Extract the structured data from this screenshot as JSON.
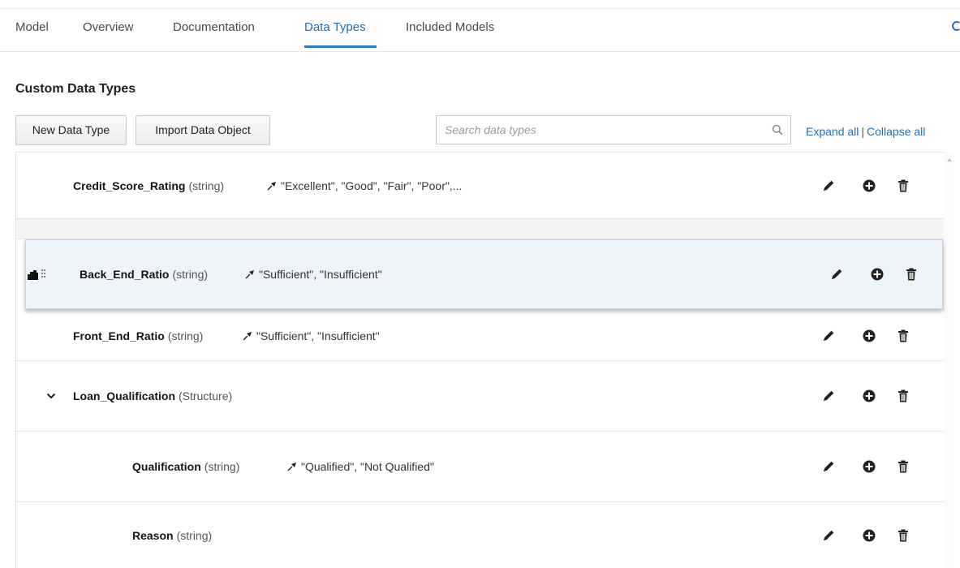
{
  "tabs": [
    {
      "label": "Model",
      "active": false
    },
    {
      "label": "Overview",
      "active": false
    },
    {
      "label": "Documentation",
      "active": false
    },
    {
      "label": "Data Types",
      "active": true
    },
    {
      "label": "Included Models",
      "active": false
    }
  ],
  "section": {
    "title": "Custom Data Types"
  },
  "toolbar": {
    "new_label": "New Data Type",
    "import_label": "Import Data Object",
    "search_placeholder": "Search data types",
    "expand_all": "Expand all",
    "separator": "|",
    "collapse_all": "Collapse all"
  },
  "rows": [
    {
      "name": "Credit_Score_Rating",
      "type": "(string)",
      "constraint": "\"Excellent\", \"Good\", \"Fair\", \"Poor\",..."
    },
    {
      "name": "Back_End_Ratio",
      "type": "(string)",
      "constraint": "\"Sufficient\", \"Insufficient\"",
      "dragging": true
    },
    {
      "name": "Front_End_Ratio",
      "type": "(string)",
      "constraint": "\"Sufficient\", \"Insufficient\""
    },
    {
      "name": "Loan_Qualification",
      "type": "(Structure)",
      "expanded": true
    },
    {
      "name": "Qualification",
      "type": "(string)",
      "constraint": "\"Qualified\", \"Not Qualified\""
    },
    {
      "name": "Reason",
      "type": "(string)"
    }
  ],
  "colors": {
    "accent": "#1f6fb8",
    "drag_bg": "#edf4fc"
  },
  "icons": {
    "edit": "pencil-icon",
    "add": "plus-circle-icon",
    "delete": "trash-icon",
    "constraint": "constraint-icon",
    "search": "search-icon",
    "expand": "chevron-down-icon",
    "drag": "drag-handle-icon"
  }
}
